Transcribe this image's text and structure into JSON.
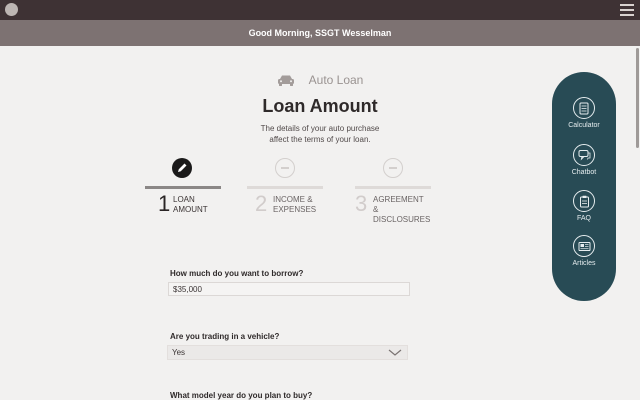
{
  "header_bar": {
    "logo_icon": "circle-logo-icon",
    "menu_icon": "hamburger-icon"
  },
  "greeting": "Good Morning, SSGT Wesselman",
  "loan": {
    "type_icon": "car-icon",
    "type_label": "Auto Loan",
    "title": "Loan Amount",
    "subtitle": "The details of your auto purchase affect the terms of your loan."
  },
  "steps": [
    {
      "number": "1",
      "label_line1": "LOAN",
      "label_line2": "AMOUNT",
      "icon": "pencil-icon",
      "state": "active"
    },
    {
      "number": "2",
      "label_line1": "INCOME &",
      "label_line2": "EXPENSES",
      "icon": "minus-circle-icon",
      "state": "inactive"
    },
    {
      "number": "3",
      "label_line1": "AGREEMENT",
      "label_line2": "& DISCLOSURES",
      "icon": "minus-circle-icon",
      "state": "inactive"
    }
  ],
  "form": {
    "borrow_label": "How much do you want to borrow?",
    "borrow_value": "$35,000",
    "trade_label": "Are you trading in a vehicle?",
    "trade_value": "Yes",
    "model_year_label": "What model year do you plan to buy?"
  },
  "side_panel": {
    "items": [
      {
        "label": "Calculator",
        "icon": "calculator-icon"
      },
      {
        "label": "Chatbot",
        "icon": "chat-bubble-icon"
      },
      {
        "label": "FAQ",
        "icon": "clipboard-icon"
      },
      {
        "label": "Articles",
        "icon": "newspaper-icon"
      }
    ]
  },
  "colors": {
    "top_bar": "#3e3234",
    "greeting_bar": "#7d7272",
    "side_panel": "#284b55",
    "background": "#f2f1f0"
  }
}
